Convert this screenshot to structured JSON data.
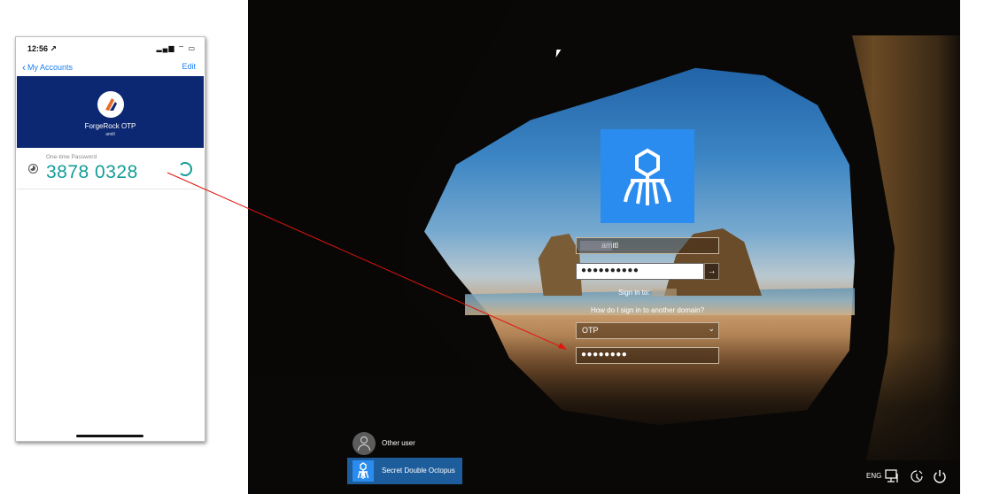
{
  "phone": {
    "status": {
      "time": "12:56 ↗",
      "icons": "▂▄▆ ⌔ ▭"
    },
    "nav": {
      "back_label": "My Accounts",
      "edit_label": "Edit"
    },
    "account": {
      "name": "ForgeRock OTP",
      "user": "amitl"
    },
    "otp": {
      "label": "One-time Password",
      "code": "3878 0328"
    }
  },
  "desktop": {
    "username_value": "amitl",
    "password_dots": "●●●●●●●●●●",
    "submit_glyph": "→",
    "sign_in_prefix": "Sign in to:",
    "how_link": "How do I sign in to another domain?",
    "provider_value": "OTP",
    "otp_dots": "●●●●●●●●",
    "users": [
      {
        "label": "Other user"
      },
      {
        "label": "Secret Double Octopus"
      }
    ],
    "tray": {
      "language": "ENG"
    }
  },
  "colors": {
    "otp_teal": "#139c98",
    "ios_blue": "#1a7ff5",
    "forgerock_navy": "#0c2872",
    "sdo_blue": "#2b8cf0",
    "annotation_red": "#e0140e"
  }
}
